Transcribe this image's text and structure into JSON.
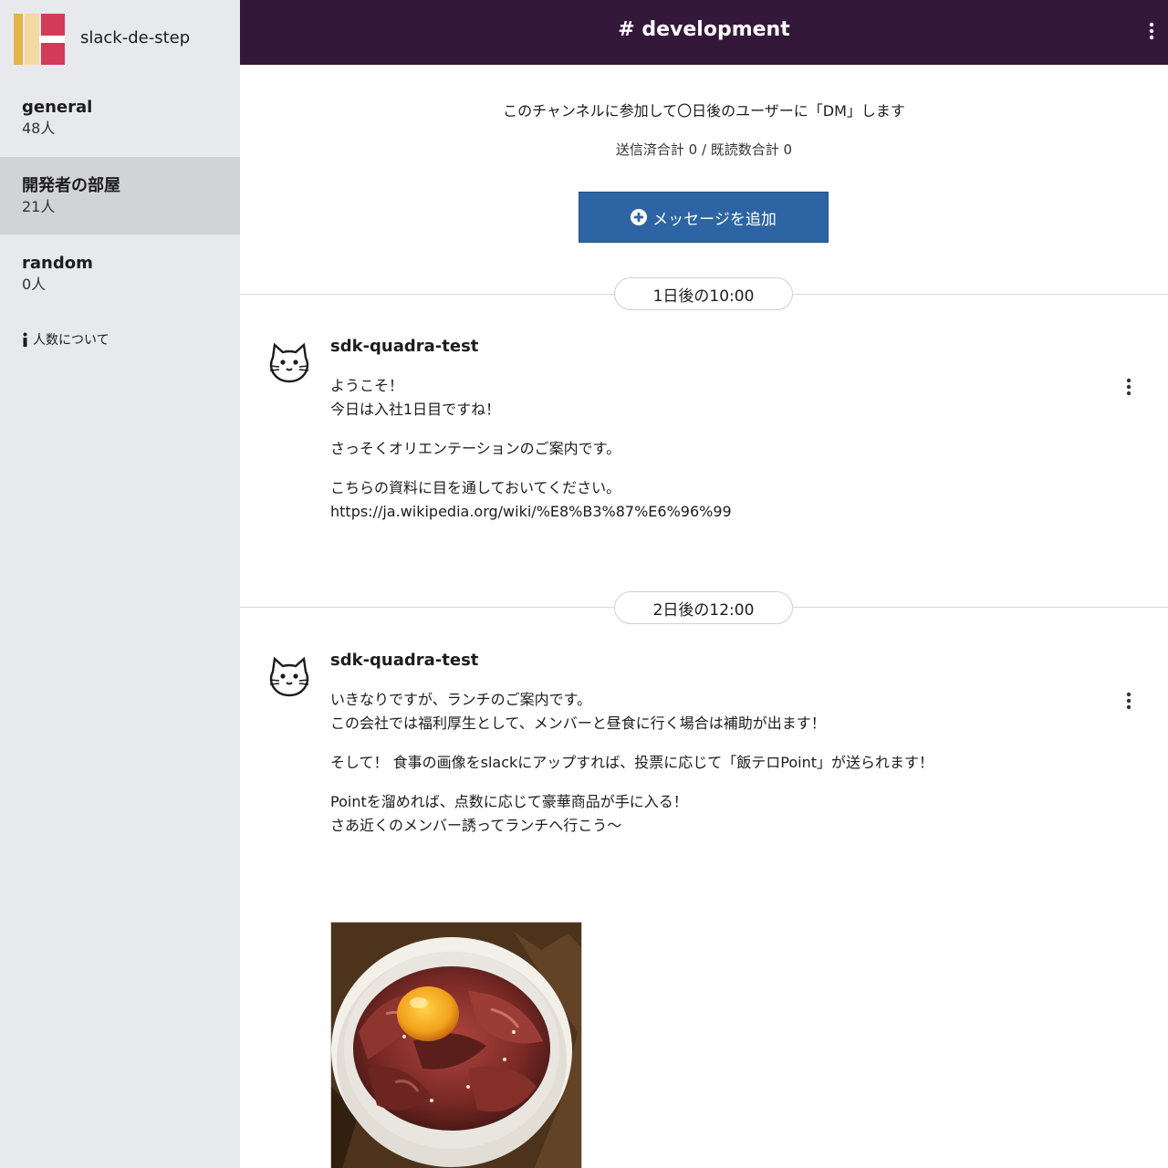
{
  "workspace": {
    "name": "slack-de-step"
  },
  "sidebar": {
    "channels": [
      {
        "name": "general",
        "count": "48人"
      },
      {
        "name": "開発者の部屋",
        "count": "21人"
      },
      {
        "name": "random",
        "count": "0人"
      }
    ],
    "about_label": "人数について"
  },
  "header": {
    "title": "# development"
  },
  "main": {
    "description": "このチャンネルに参加して〇日後のユーザーに「DM」します",
    "stats": "送信済合計 0 / 既読数合計 0",
    "add_button_label": "メッセージを追加"
  },
  "messages": [
    {
      "time": "1日後の10:00",
      "author": "sdk-quadra-test",
      "paragraphs": [
        [
          "ようこそ！",
          "今日は入社1日目ですね！"
        ],
        [
          "さっそくオリエンテーションのご案内です。"
        ],
        [
          "こちらの資料に目を通しておいてください。",
          "https://ja.wikipedia.org/wiki/%E8%B3%87%E6%96%99"
        ]
      ]
    },
    {
      "time": "2日後の12:00",
      "author": "sdk-quadra-test",
      "paragraphs": [
        [
          "いきなりですが、ランチのご案内です。",
          "この会社では福利厚生として、メンバーと昼食に行く場合は補助が出ます！"
        ],
        [
          "そして！ 食事の画像をslackにアップすれば、投票に応じて「飯テロPoint」が送られます！"
        ],
        [
          "Pointを溜めれば、点数に応じて豪華商品が手に入る！",
          "さあ近くのメンバー誘ってランチへ行こう〜"
        ]
      ],
      "image": "beef-bowl-photo"
    }
  ],
  "colors": {
    "header_bg": "#34183a",
    "sidebar_bg": "#e8e9ed",
    "sidebar_active": "#d2d3d6",
    "button_bg": "#2d64a3"
  },
  "icons": [
    "workspace-logo",
    "info-icon",
    "kebab-menu-icon",
    "plus-circle-icon",
    "cat-avatar-icon"
  ]
}
